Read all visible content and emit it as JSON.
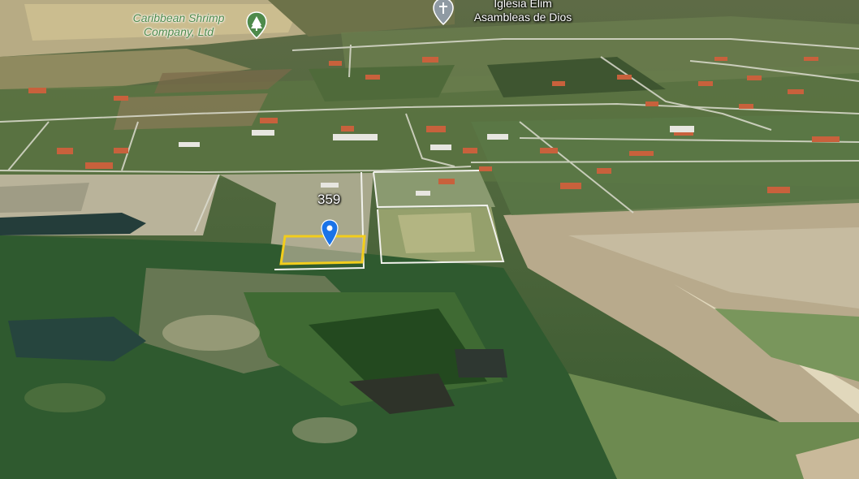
{
  "map": {
    "places": [
      {
        "name_line1": "Caribbean Shrimp",
        "name_line2": "Company, Ltd",
        "icon": "tree-icon",
        "color": "#4e8a4b"
      },
      {
        "name_line1": "Iglesia Elim",
        "name_line2": "Asambleas de Dios",
        "icon": "cross-icon",
        "color": "#ffffff"
      }
    ],
    "parcel": {
      "number": "359",
      "highlight_color": "#f2cd1c",
      "marker": "location-pin-icon",
      "marker_color": "#1a73e8"
    }
  }
}
